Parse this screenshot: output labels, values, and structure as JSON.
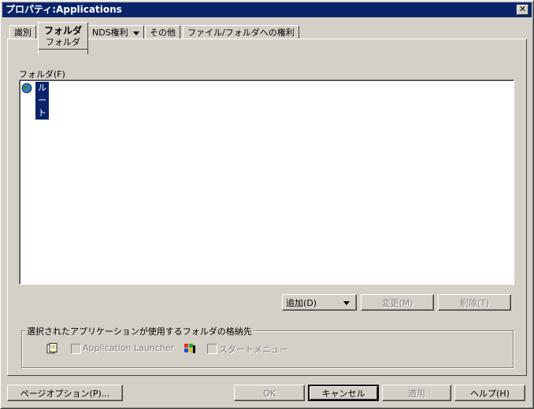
{
  "window": {
    "title": "プロパティ:Applications",
    "close_label": "✕"
  },
  "tabs": [
    {
      "label": "識別"
    },
    {
      "label": "フォルダ",
      "sub": "フォルダ"
    },
    {
      "label": "NDS権利"
    },
    {
      "label": "その他"
    },
    {
      "label": "ファイル/フォルダへの権利"
    }
  ],
  "folder_section": {
    "label": "フォルダ(F)",
    "tree": [
      {
        "label": "ルート",
        "icon": "globe-icon",
        "selected": true
      }
    ]
  },
  "folder_buttons": {
    "add": "追加(D)",
    "change": "変更(M)",
    "delete": "削除(T)"
  },
  "storage_group": {
    "label": "選択されたアプリケーションが使用するフォルダの格納先",
    "app_launcher": {
      "label": "Application Launcher",
      "checked": false,
      "enabled": false
    },
    "start_menu": {
      "label": "スタートメニュー",
      "checked": false,
      "enabled": false
    }
  },
  "footer": {
    "page_options": "ページオプション(P)...",
    "ok": "OK",
    "cancel": "キャンセル",
    "apply": "適用",
    "help": "ヘルプ(H)"
  },
  "colors": {
    "titlebar": "#0a246a",
    "face": "#d4d0c8",
    "selection": "#0a246a"
  }
}
